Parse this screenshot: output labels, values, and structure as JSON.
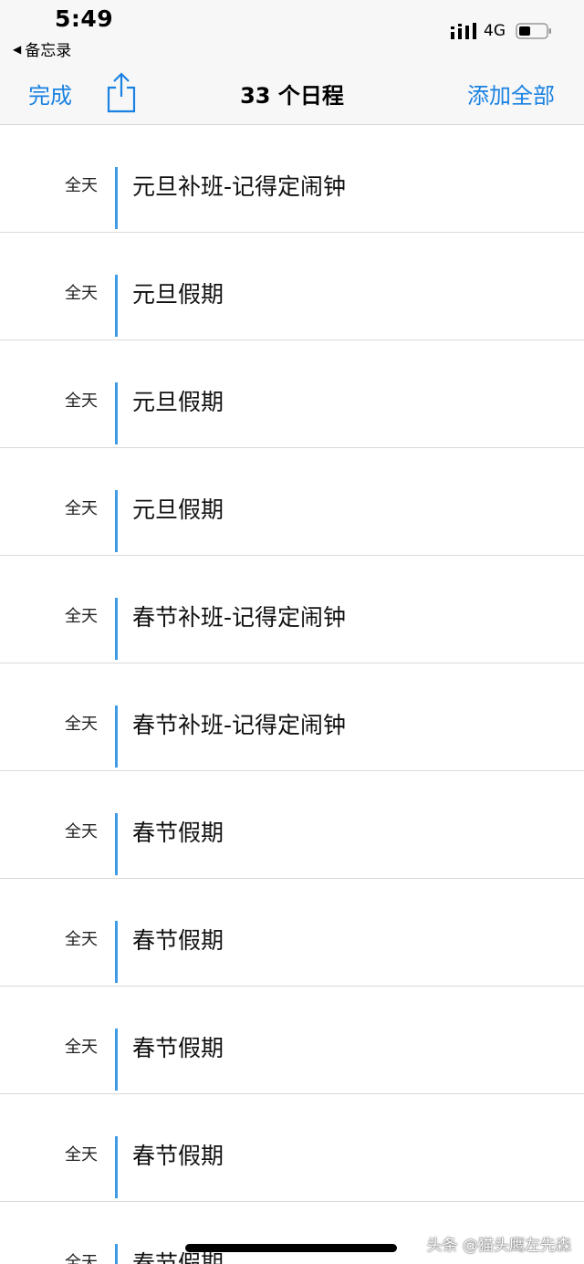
{
  "status_bar": {
    "time": "5:49",
    "back_app": "备忘录",
    "network": "4G"
  },
  "nav": {
    "done_label": "完成",
    "title": "33 个日程",
    "add_all_label": "添加全部"
  },
  "events": [
    {
      "time": "全天",
      "title": "元旦补班-记得定闹钟"
    },
    {
      "time": "全天",
      "title": "元旦假期"
    },
    {
      "time": "全天",
      "title": "元旦假期"
    },
    {
      "time": "全天",
      "title": "元旦假期"
    },
    {
      "time": "全天",
      "title": "春节补班-记得定闹钟"
    },
    {
      "time": "全天",
      "title": "春节补班-记得定闹钟"
    },
    {
      "time": "全天",
      "title": "春节假期"
    },
    {
      "time": "全天",
      "title": "春节假期"
    },
    {
      "time": "全天",
      "title": "春节假期"
    },
    {
      "time": "全天",
      "title": "春节假期"
    },
    {
      "time": "全天",
      "title": "春节假期"
    }
  ],
  "watermark": "头条 @猫头鹰左先森",
  "colors": {
    "accent": "#1a82e2",
    "event_bar": "#3f9be6"
  }
}
